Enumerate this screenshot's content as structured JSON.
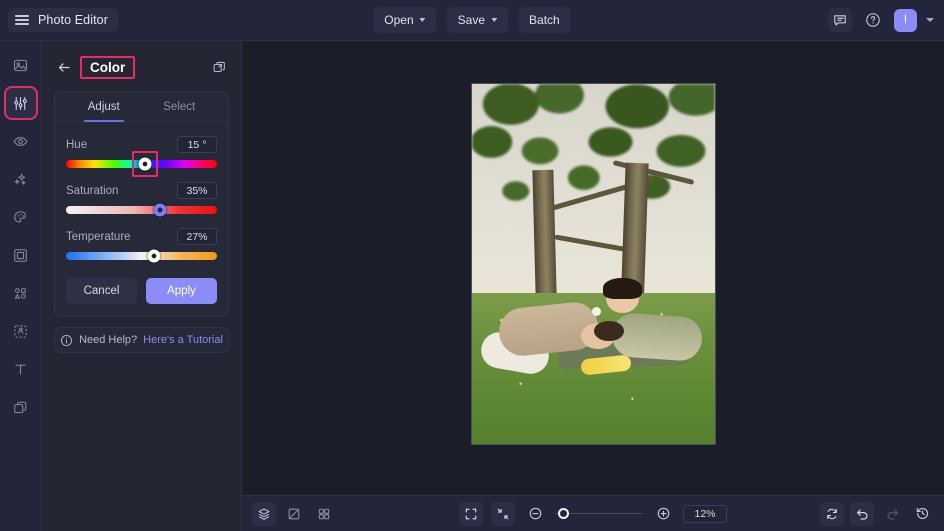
{
  "header": {
    "menu_icon": "hamburger-icon",
    "brand_title": "Photo Editor",
    "open_label": "Open",
    "save_label": "Save",
    "batch_label": "Batch",
    "feedback_icon": "chat-bubble-icon",
    "help_icon": "question-circle-icon",
    "avatar_initial": "I"
  },
  "rail": {
    "items": [
      {
        "name": "sidebar-item-image",
        "icon": "image-icon",
        "selected": false
      },
      {
        "name": "sidebar-item-adjust",
        "icon": "sliders-icon",
        "selected": true
      },
      {
        "name": "sidebar-item-effects",
        "icon": "eye-icon",
        "selected": false
      },
      {
        "name": "sidebar-item-magic",
        "icon": "sparkles-icon",
        "selected": false
      },
      {
        "name": "sidebar-item-retouch",
        "icon": "palette-icon",
        "selected": false
      },
      {
        "name": "sidebar-item-frame",
        "icon": "frame-icon",
        "selected": false
      },
      {
        "name": "sidebar-item-elements",
        "icon": "shapes-icon",
        "selected": false
      },
      {
        "name": "sidebar-item-cutout",
        "icon": "cutout-icon",
        "selected": false
      },
      {
        "name": "sidebar-item-text",
        "icon": "text-t-icon",
        "selected": false
      },
      {
        "name": "sidebar-item-layers",
        "icon": "layers-copy-icon",
        "selected": false
      }
    ]
  },
  "panel": {
    "back_icon": "arrow-left-icon",
    "title": "Color",
    "duplicate_icon": "duplicate-icon",
    "tabs": [
      {
        "label": "Adjust",
        "active": true
      },
      {
        "label": "Select",
        "active": false
      }
    ],
    "controls": [
      {
        "label": "Hue",
        "value": "15 °",
        "percent": 52,
        "highlighted": true
      },
      {
        "label": "Saturation",
        "value": "35%",
        "percent": 62,
        "highlighted": false
      },
      {
        "label": "Temperature",
        "value": "27%",
        "percent": 58,
        "highlighted": false
      }
    ],
    "cancel_label": "Cancel",
    "apply_label": "Apply",
    "help_icon": "info-circle-icon",
    "help_text": "Need Help?",
    "help_link": "Here's a Tutorial"
  },
  "canvas": {
    "image_alt": "couple-lying-on-grass-under-trees"
  },
  "bottombar": {
    "layers_icon": "layers-icon",
    "compare_icon": "compare-split-icon",
    "grid_icon": "grid-icon",
    "fit_icon": "fit-screen-icon",
    "actual_icon": "shrink-to-fit-icon",
    "zoom_out_icon": "zoom-out-icon",
    "zoom_in_icon": "zoom-in-icon",
    "zoom_value": "12%",
    "reset_icon": "reset-icon",
    "undo_icon": "undo-icon",
    "redo_icon": "redo-icon",
    "history_icon": "history-icon"
  },
  "colors": {
    "accent_purple": "#8b8cf7",
    "highlight_pink": "#ea2a62",
    "header_bg": "#23263a",
    "panel_bg": "#242634",
    "canvas_bg": "#1b1d29"
  }
}
